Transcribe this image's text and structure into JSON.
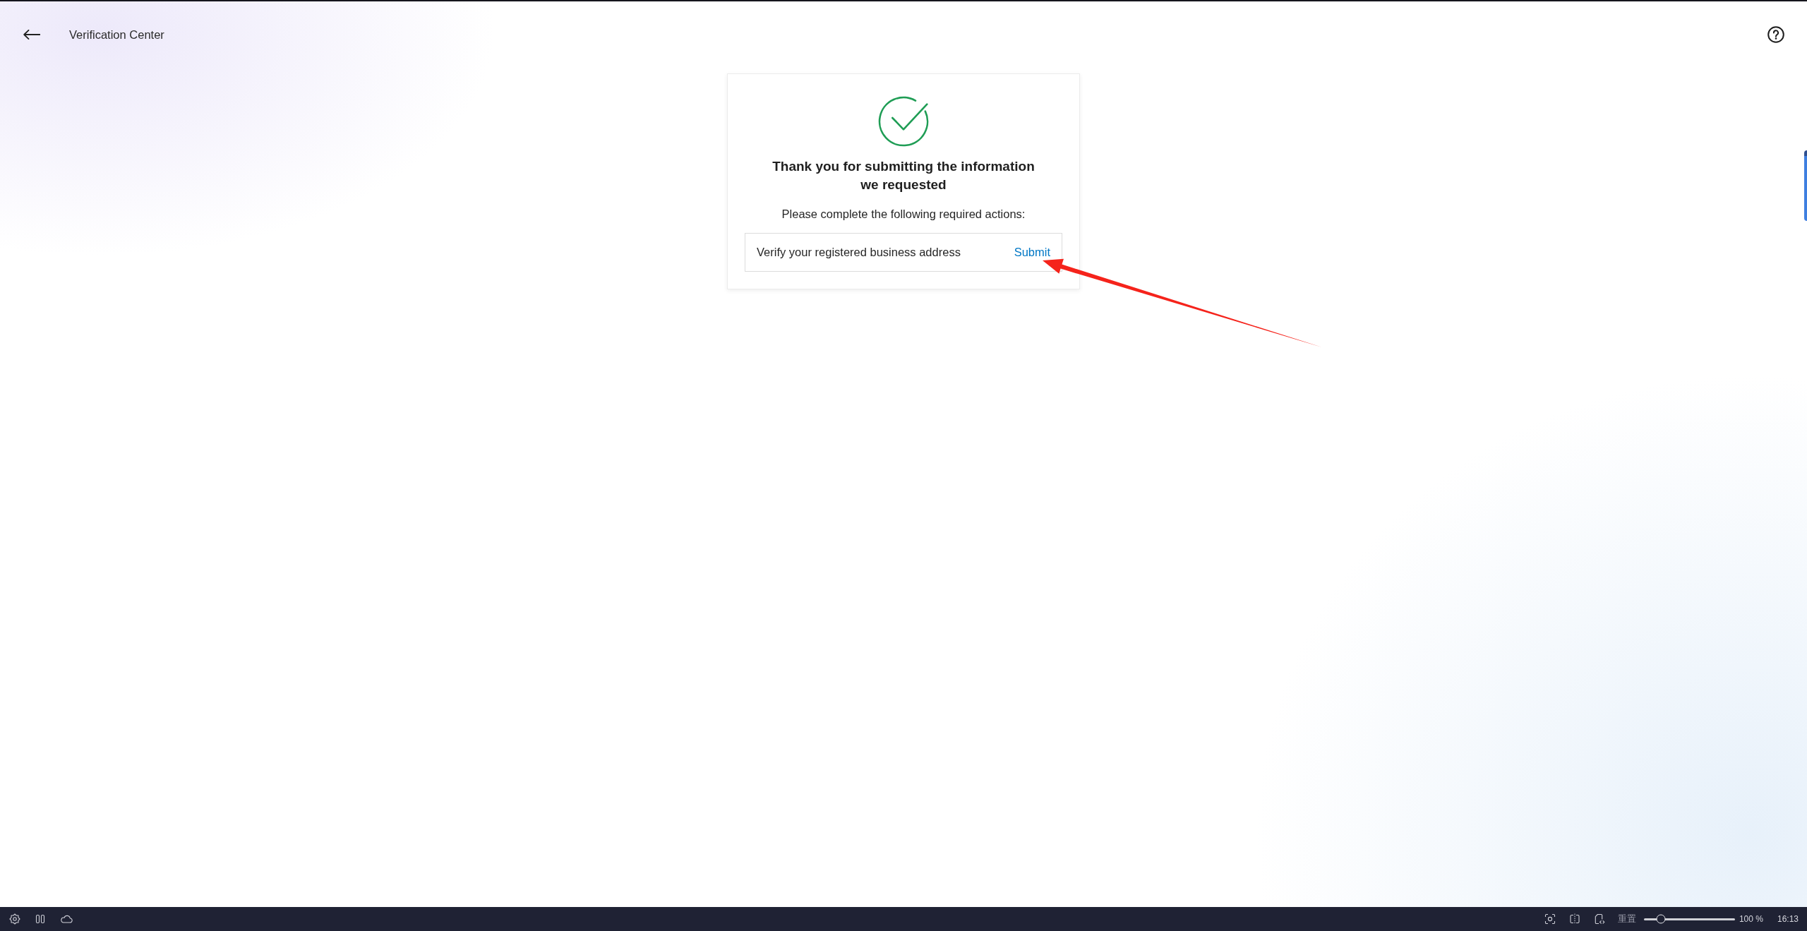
{
  "header": {
    "title": "Verification Center"
  },
  "card": {
    "title": "Thank you for submitting the information we requested",
    "subtitle": "Please complete the following required actions:",
    "actions": [
      {
        "label": "Verify your registered business address",
        "link": "Submit"
      }
    ]
  },
  "taskbar": {
    "reset": "重置",
    "zoom": {
      "level": 0.19,
      "reading": "100 %"
    },
    "clock": "16:13"
  }
}
